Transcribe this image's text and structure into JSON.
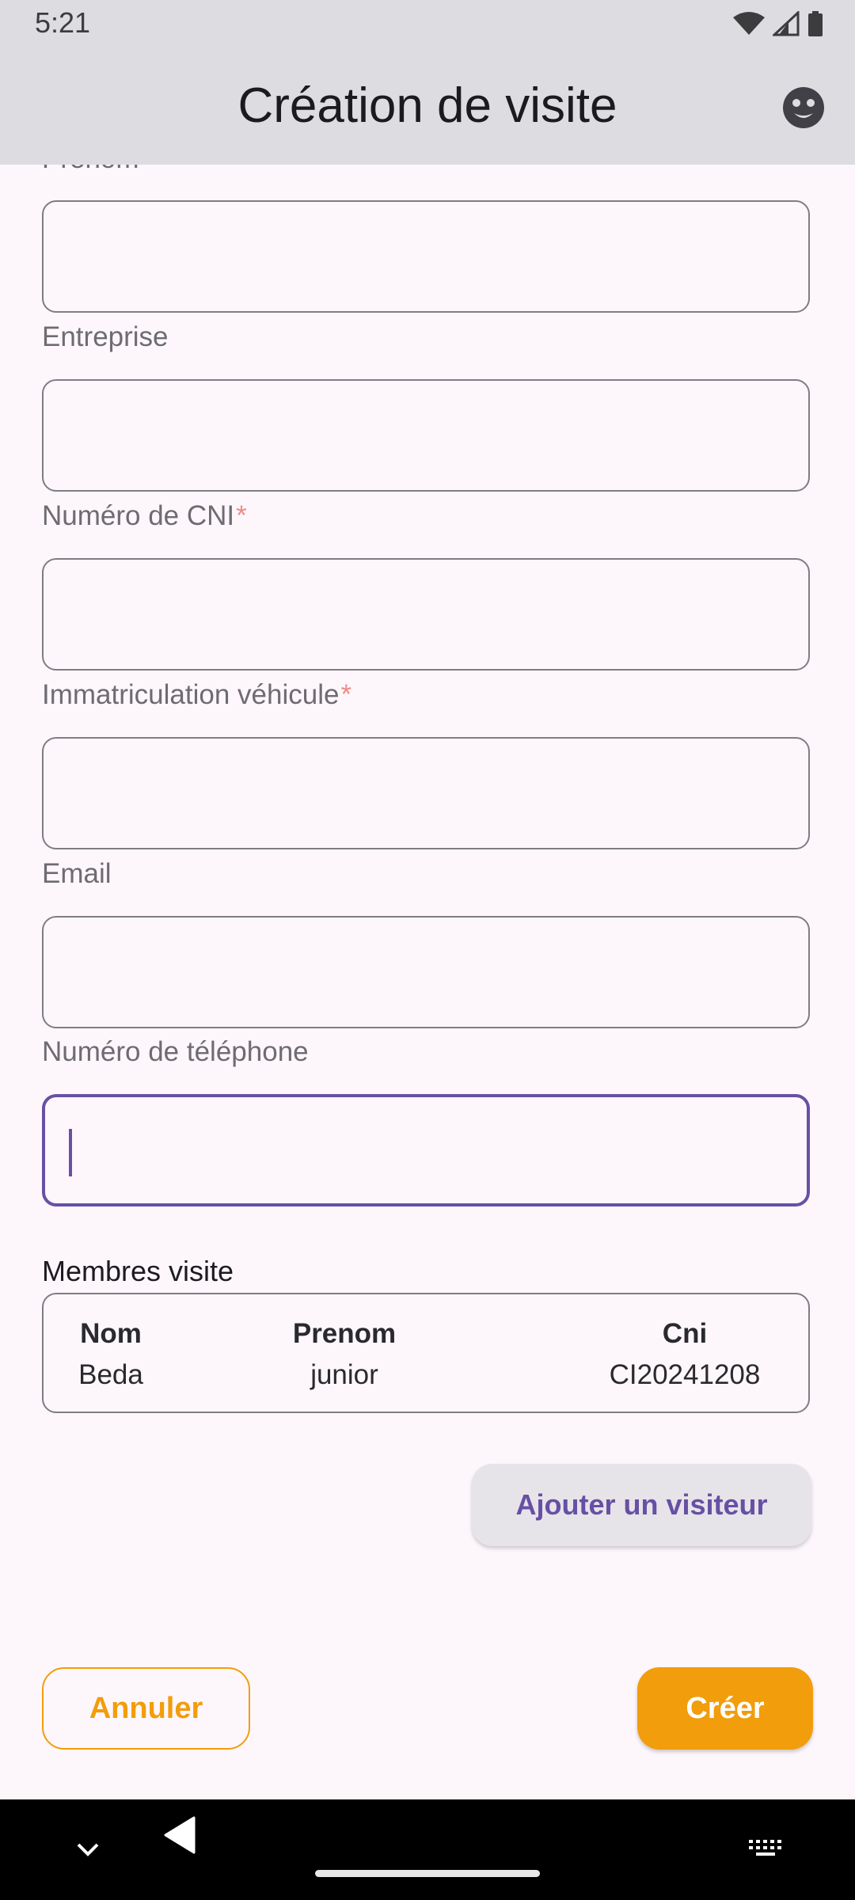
{
  "status_bar": {
    "time": "5:21",
    "icons": [
      "wifi-icon",
      "signal-icon",
      "battery-icon"
    ]
  },
  "app_bar": {
    "title": "Création de visite",
    "action_icon": "face-icon"
  },
  "form": {
    "partial_label": "Prenom",
    "fields": [
      {
        "label": "",
        "value": ""
      },
      {
        "label": "Entreprise",
        "required": false,
        "value": ""
      },
      {
        "label": "Numéro de CNI",
        "required": true,
        "value": ""
      },
      {
        "label": "Immatriculation véhicule",
        "required": true,
        "value": ""
      },
      {
        "label": "Email",
        "required": false,
        "value": ""
      },
      {
        "label": "Numéro de téléphone",
        "required": false,
        "value": "",
        "focused": true
      }
    ],
    "required_marker": "*"
  },
  "members": {
    "title": "Membres visite",
    "headers": [
      "Nom",
      "Prenom",
      "Cni"
    ],
    "rows": [
      [
        "Beda",
        "junior",
        "CI20241208"
      ]
    ]
  },
  "buttons": {
    "add_visitor": "Ajouter un visiteur",
    "cancel": "Annuler",
    "create": "Créer"
  },
  "colors": {
    "accent": "#6750a4",
    "primary_action": "#f29d0b",
    "app_bar": "#dddce1",
    "background": "#fdf7fc"
  },
  "nav_bar": {
    "icons": [
      "chevron-down-icon",
      "back-icon",
      "home-pill",
      "keyboard-icon"
    ]
  }
}
